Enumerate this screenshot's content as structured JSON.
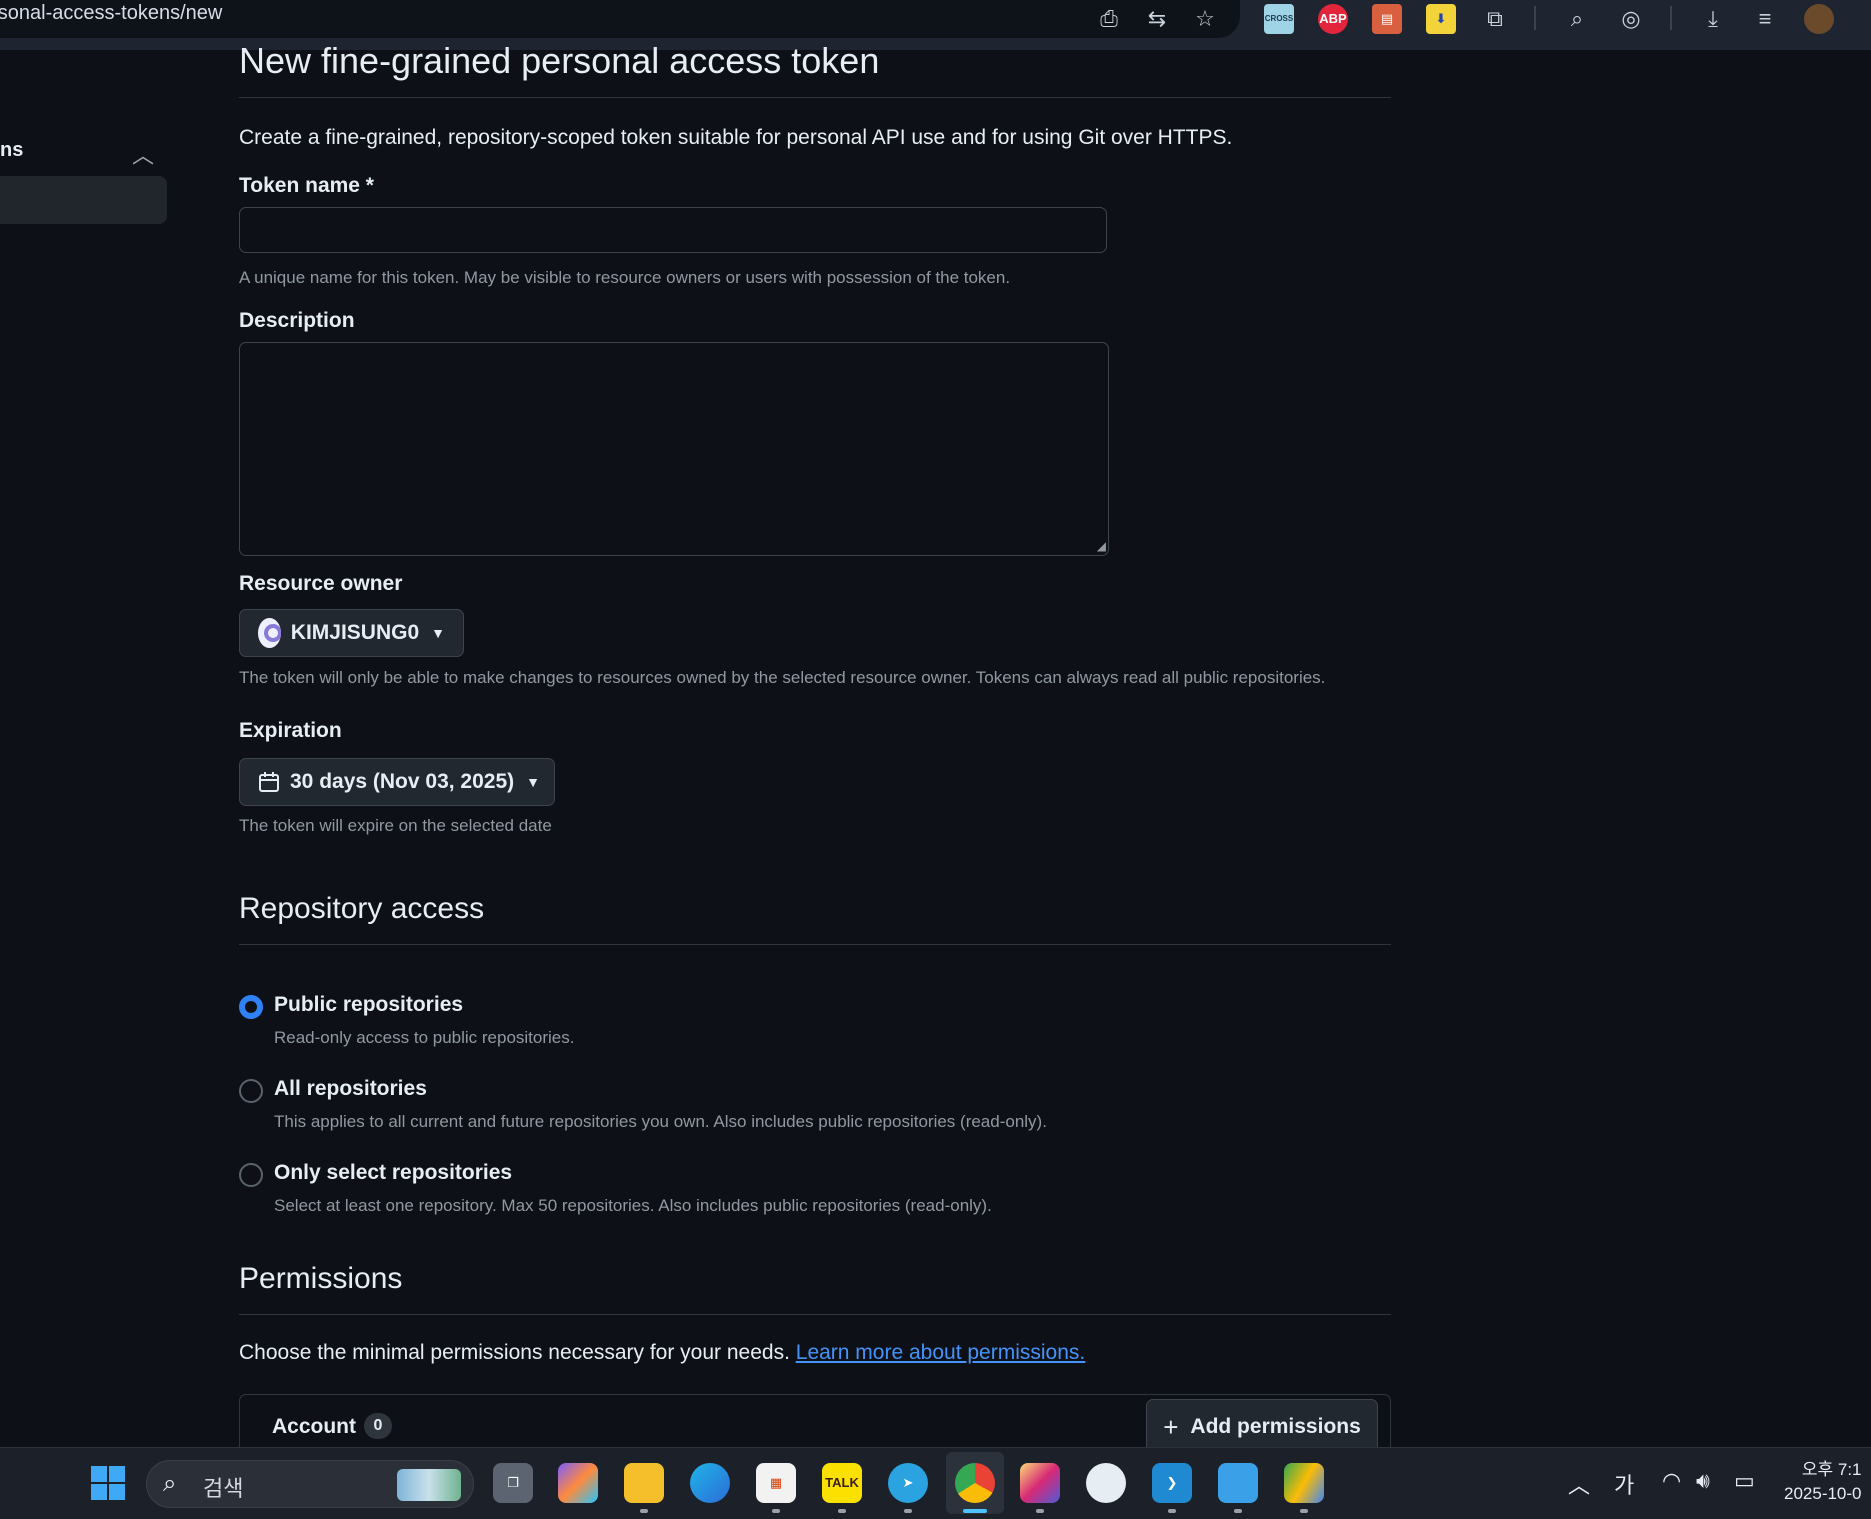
{
  "browser": {
    "url": "personal-access-tokens/new",
    "url_visible": "ersonal-access-tokens/new"
  },
  "sidebar": {
    "section_label": "ns"
  },
  "page": {
    "title": "New fine-grained personal access token",
    "intro": "Create a fine-grained, repository-scoped token suitable for personal API use and for using Git over HTTPS."
  },
  "token_name": {
    "label": "Token name *",
    "value": "",
    "hint": "A unique name for this token. May be visible to resource owners or users with possession of the token."
  },
  "description": {
    "label": "Description",
    "value": ""
  },
  "resource_owner": {
    "label": "Resource owner",
    "selected": "KIMJISUNG0",
    "hint": "The token will only be able to make changes to resources owned by the selected resource owner. Tokens can always read all public repositories."
  },
  "expiration": {
    "label": "Expiration",
    "selected": "30 days (Nov 03, 2025)",
    "hint": "The token will expire on the selected date"
  },
  "repository_access": {
    "heading": "Repository access",
    "options": [
      {
        "label": "Public repositories",
        "desc": "Read-only access to public repositories.",
        "selected": true
      },
      {
        "label": "All repositories",
        "desc": "This applies to all current and future repositories you own. Also includes public repositories (read-only).",
        "selected": false
      },
      {
        "label": "Only select repositories",
        "desc": "Select at least one repository. Max 50 repositories. Also includes public repositories (read-only).",
        "selected": false
      }
    ]
  },
  "permissions": {
    "heading": "Permissions",
    "text": "Choose the minimal permissions necessary for your needs.",
    "link": "Learn more about permissions.",
    "account_label": "Account",
    "account_count": "0",
    "add_button": "Add permissions"
  },
  "taskbar": {
    "search_text": "검색",
    "ime": "가",
    "time": "오후 7:1",
    "date": "2025-10-0",
    "apps": [
      "start-icon",
      "task-view-icon",
      "copilot-icon",
      "file-explorer-icon",
      "edge-icon",
      "store-icon",
      "kakaotalk-icon",
      "telegram-icon",
      "chrome-icon",
      "instagram-icon",
      "github-icon",
      "vscode-icon",
      "app-icon",
      "google-drive-icon"
    ]
  },
  "colors": {
    "background": "#0d1117",
    "accent": "#2f81f7",
    "link": "#4493f8",
    "muted": "#9198a1"
  }
}
